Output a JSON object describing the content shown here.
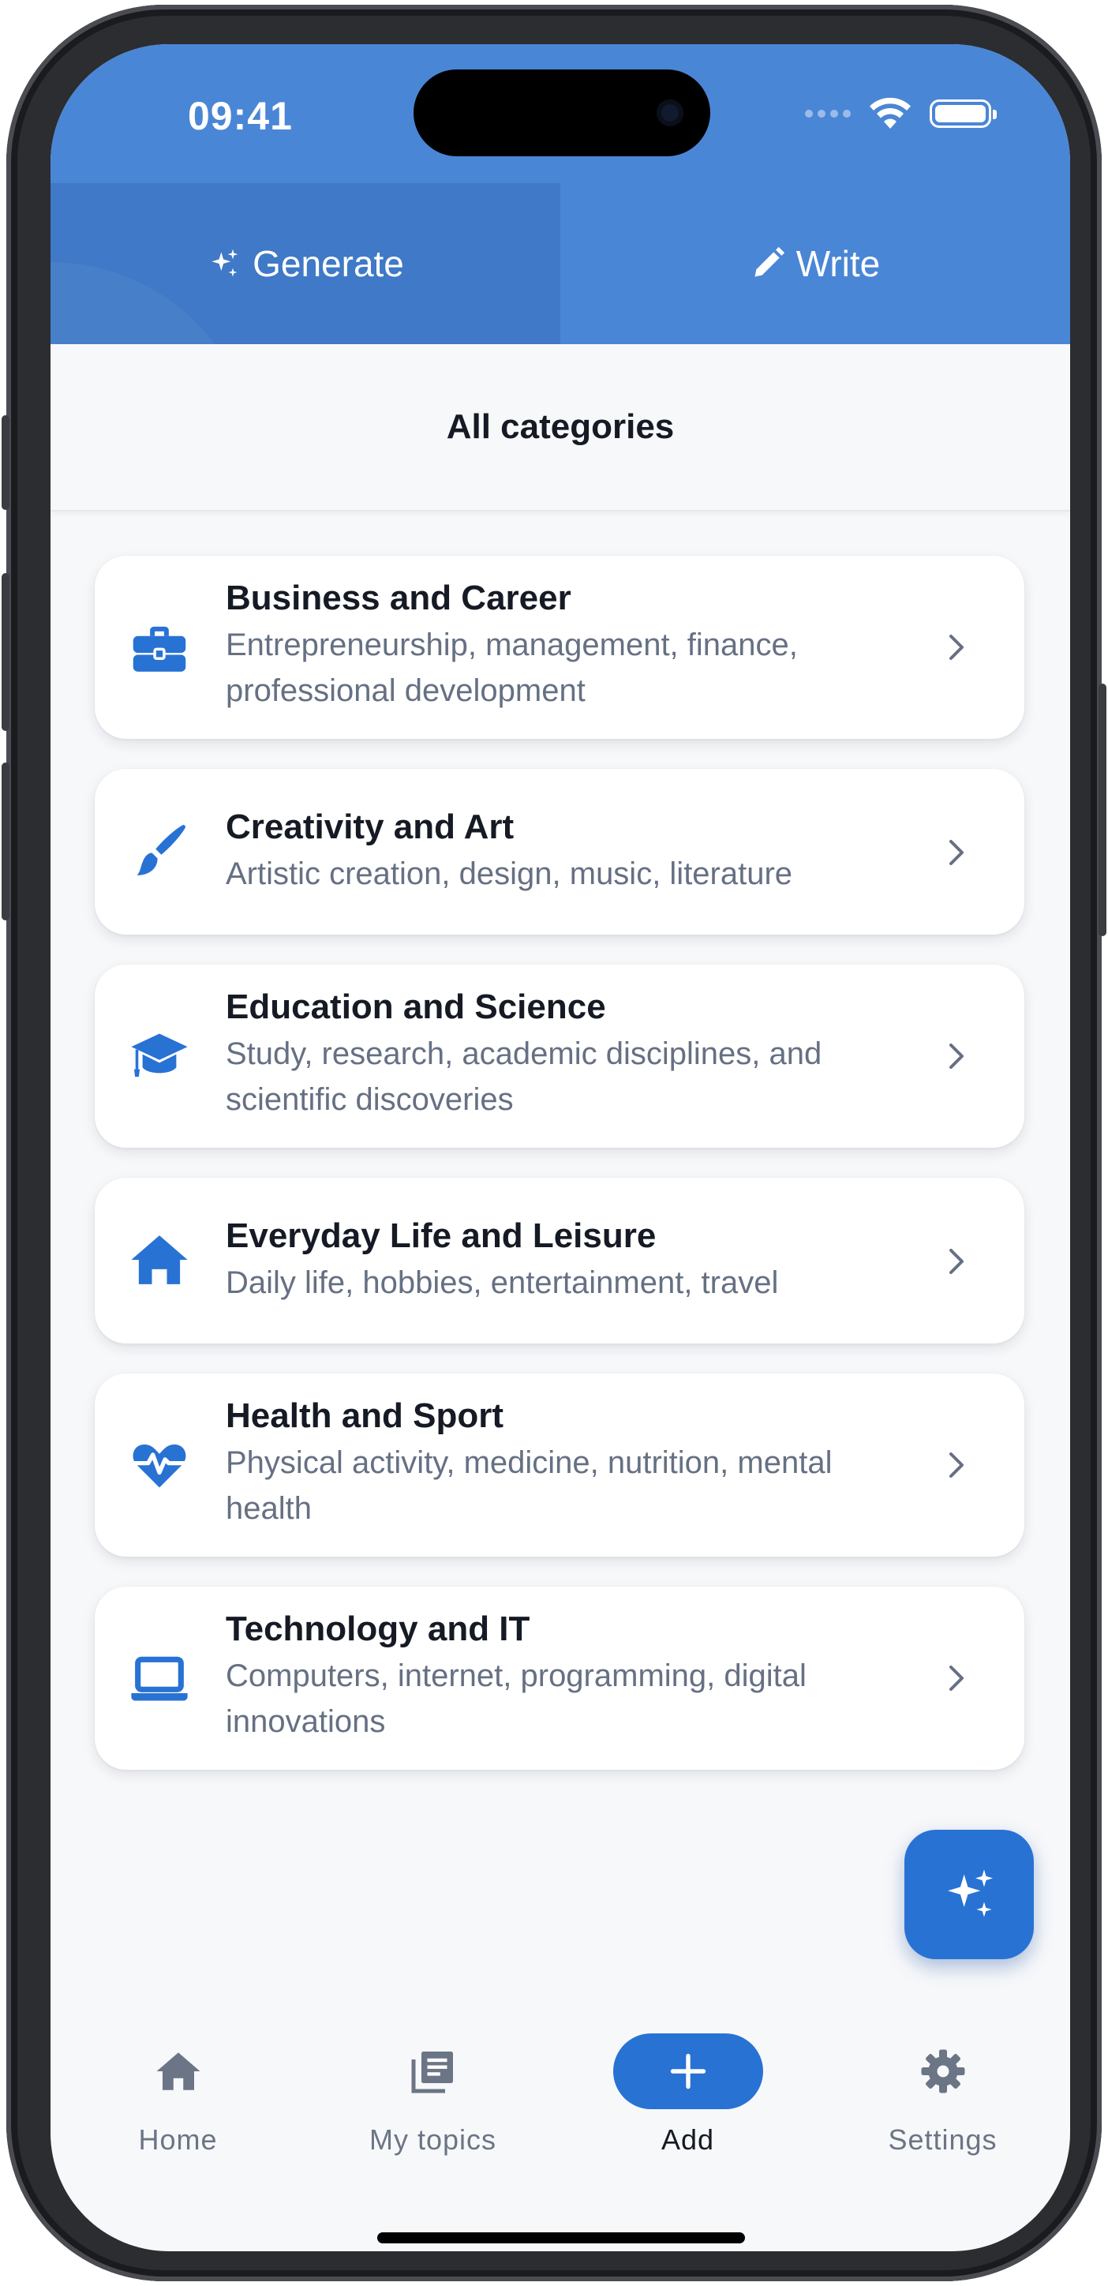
{
  "status_bar": {
    "time": "09:41"
  },
  "tabs": [
    {
      "label": "Generate",
      "icon": "sparkles-icon",
      "active": true
    },
    {
      "label": "Write",
      "icon": "pencil-icon",
      "active": false
    }
  ],
  "page_title": "All categories",
  "categories": [
    {
      "title": "Business and Career",
      "description": "Entrepreneurship, management, finance, professional development",
      "icon": "briefcase-icon"
    },
    {
      "title": "Creativity and Art",
      "description": "Artistic creation, design, music, literature",
      "icon": "paintbrush-icon"
    },
    {
      "title": "Education and Science",
      "description": "Study, research, academic disciplines, and scientific discoveries",
      "icon": "graduation-cap-icon"
    },
    {
      "title": "Everyday Life and Leisure",
      "description": "Daily life, hobbies, entertainment, travel",
      "icon": "house-icon"
    },
    {
      "title": "Health and Sport",
      "description": "Physical activity, medicine, nutrition, mental health",
      "icon": "heart-pulse-icon"
    },
    {
      "title": "Technology and IT",
      "description": "Computers, internet, programming, digital innovations",
      "icon": "laptop-icon"
    }
  ],
  "fab": {
    "icon": "sparkles-icon"
  },
  "bottom_nav": [
    {
      "label": "Home",
      "icon": "home-icon"
    },
    {
      "label": "My topics",
      "icon": "topics-icon"
    },
    {
      "label": "Add",
      "icon": "plus-icon",
      "active": true
    },
    {
      "label": "Settings",
      "icon": "gear-icon"
    }
  ],
  "colors": {
    "primary": "#2872d4",
    "header": "#4a86d6",
    "text": "#151a24",
    "muted": "#667083"
  }
}
